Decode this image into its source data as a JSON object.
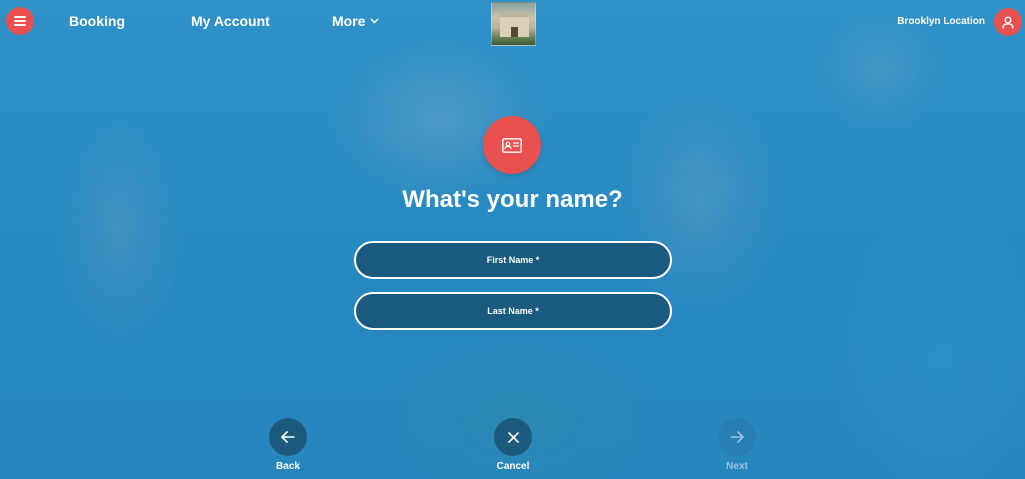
{
  "nav": {
    "links": [
      {
        "label": "Booking"
      },
      {
        "label": "My Account"
      },
      {
        "label": "More"
      }
    ],
    "location": "Brooklyn Location"
  },
  "form": {
    "heading": "What's your name?",
    "first_name_placeholder": "First Name *",
    "last_name_placeholder": "Last Name *",
    "first_name_value": "",
    "last_name_value": ""
  },
  "actions": {
    "back_label": "Back",
    "cancel_label": "Cancel",
    "next_label": "Next"
  },
  "icons": {
    "menu": "hamburger-menu-icon",
    "more": "chevron-down-icon",
    "user": "user-icon",
    "card": "id-card-icon",
    "back": "arrow-left-icon",
    "cancel": "close-icon",
    "next": "arrow-right-icon"
  },
  "colors": {
    "accent": "#e8514f",
    "field_bg": "#1a5a7f",
    "button_bg": "#1c5b7e"
  }
}
